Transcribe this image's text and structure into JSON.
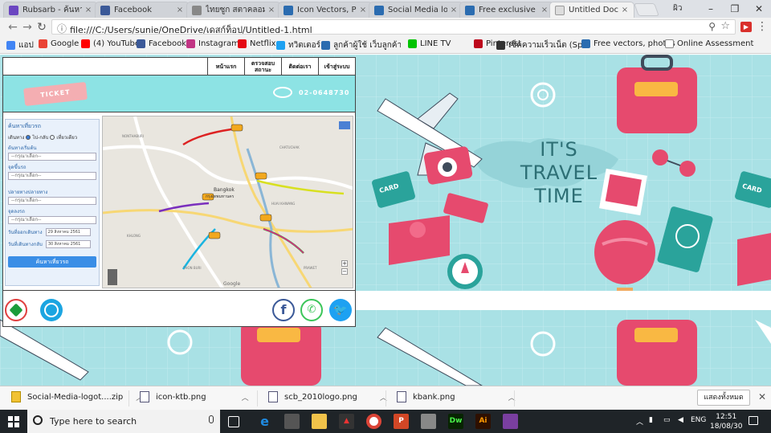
{
  "browser": {
    "tabs": [
      {
        "title": "Rubsarb - ค้นหาเ",
        "color": "#6b46c1"
      },
      {
        "title": "Facebook",
        "color": "#3b5998"
      },
      {
        "title": "ไทยซูก สตาคลอม - จะ",
        "color": "#888888"
      },
      {
        "title": "Icon Vectors, Photo",
        "color": "#2b6cb0"
      },
      {
        "title": "Social Media logoty",
        "color": "#2b6cb0"
      },
      {
        "title": "Free exclusive vect",
        "color": "#2b6cb0"
      },
      {
        "title": "Untitled Document",
        "color": "#dddddd"
      }
    ],
    "user_label": "ผิว",
    "url": "file:///C:/Users/sunie/OneDrive/เดสก์ท็อป/Untitled-1.html",
    "bookmarks": [
      {
        "label": "แอป",
        "color": "#4285f4"
      },
      {
        "label": "Google",
        "color": "#ea4335"
      },
      {
        "label": "(4) YouTube",
        "color": "#ff0000"
      },
      {
        "label": "Facebook",
        "color": "#3b5998"
      },
      {
        "label": "Instagram",
        "color": "#c13584"
      },
      {
        "label": "Netflix",
        "color": "#e50914"
      },
      {
        "label": "ทวิตเตอร์",
        "color": "#1da1f2"
      },
      {
        "label": "ลูกค้าผู้ใช้ เว็บลูกค้าผู้ดูแลอย",
        "color": "#2b6cb0"
      },
      {
        "label": "LINE TV",
        "color": "#00c300"
      },
      {
        "label": "Pinterest",
        "color": "#bd081c"
      },
      {
        "label": "เช็คความเร็วเน็ต (Speed",
        "color": "#333333"
      },
      {
        "label": "Free vectors, photos",
        "color": "#2b6cb0"
      },
      {
        "label": "Online Assessment",
        "color": "#555555"
      }
    ]
  },
  "site": {
    "nav": [
      "หน้าแรก",
      "ตรวจสอบสถานะ",
      "ติดต่อเรา",
      "เข้าสู่ระบบ"
    ],
    "ticket_text": "TICKET",
    "phone": "02-0648730",
    "form": {
      "title": "ค้นหาเที่ยวรถ",
      "trip_type_label": "เดินทาง",
      "trip_options": [
        "ไป-กลับ",
        "เที่ยวเดียว"
      ],
      "fields": [
        {
          "label": "ต้นทางเริ่มต้น",
          "placeholder": "--กรุณาเลือก--"
        },
        {
          "label": "จุดขึ้นรถ",
          "placeholder": "--กรุณาเลือก--"
        },
        {
          "label": "ปลายทางปลายทาง",
          "placeholder": "--กรุณาเลือก--"
        },
        {
          "label": "จุดลงรถ",
          "placeholder": "--กรุณาเลือก--"
        }
      ],
      "departure_label": "วันที่ออกเดินทาง",
      "departure_value": "29 สิงหาคม 2561",
      "return_label": "วันที่เดินทางกลับ",
      "return_value": "30 สิงหาคม 2561",
      "search_button": "ค้นหาเที่ยวรถ"
    },
    "map": {
      "city_label": "Bangkok",
      "city_label_th": "กรุงเทพมหานคร",
      "corner_label": "Google"
    }
  },
  "travel_art": {
    "headline_1": "IT'S",
    "headline_2": "TRAVEL",
    "headline_3": "TIME",
    "card_label": "CARD"
  },
  "downloads": [
    {
      "name": "Social-Media-logot....zip"
    },
    {
      "name": "icon-ktb.png"
    },
    {
      "name": "scb_2010logo.png"
    },
    {
      "name": "kbank.png"
    }
  ],
  "downloads_show_all": "แสดงทั้งหมด",
  "taskbar": {
    "search_placeholder": "Type here to search",
    "lang": "ENG",
    "time": "12:51",
    "date": "18/08/30"
  }
}
